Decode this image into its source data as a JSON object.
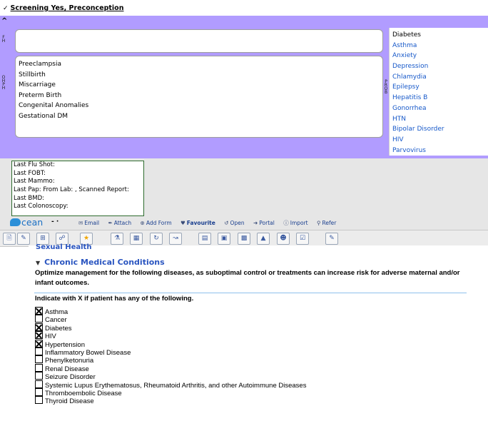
{
  "header": {
    "title": "Screening Yes, Preconception"
  },
  "purple_panel": {
    "fh_label": "F H",
    "oh_label": "O H P H",
    "prob_label": "P R O B",
    "fh_value": "",
    "oh_items": [
      "Preeclampsia",
      "Stillbirth",
      "Miscarriage",
      "Preterm Birth",
      "Congenital Anomalies",
      "Gestational DM"
    ],
    "problem_items": [
      "Diabetes",
      "Asthma",
      "Anxiety",
      "Depression",
      "Chlamydia",
      "Epilepsy",
      "Hepatitis B",
      "Gonorrhea",
      "HTN",
      "Bipolar Disorder",
      "HIV",
      "Parvovirus"
    ],
    "colors": {
      "background": "#b19cff",
      "link": "#1658c9"
    }
  },
  "last_tests": [
    "Last Flu Shot:",
    "Last FOBT:",
    "Last Mammo:",
    "Last Pap: From Lab: , Scanned Report:",
    "Last BMD:",
    "Last Colonoscopy:"
  ],
  "ocean_toolbar": {
    "logo": "cean",
    "separator": "-  ·",
    "email": "Email",
    "attach": "Attach",
    "add_form": "Add Form",
    "favourite": "Favourite",
    "open": "Open",
    "portal": "Portal",
    "import": "Import",
    "refer": "Refer"
  },
  "content": {
    "prev_section": "Sexual Health",
    "section_title": "Chronic Medical Conditions",
    "description": "Optimize management for the following diseases, as suboptimal control or treatments can increase risk for adverse maternal and/or infant outcomes.",
    "instruction": "Indicate with X if patient has any of the following.",
    "conditions": [
      {
        "label": "Asthma",
        "checked": true
      },
      {
        "label": "Cancer",
        "checked": false
      },
      {
        "label": "Diabetes",
        "checked": true
      },
      {
        "label": "HIV",
        "checked": true
      },
      {
        "label": "Hypertension",
        "checked": true
      },
      {
        "label": "Inflammatory Bowel Disease",
        "checked": false
      },
      {
        "label": "Phenylketonuria",
        "checked": false
      },
      {
        "label": "Renal Disease",
        "checked": false
      },
      {
        "label": "Seizure Disorder",
        "checked": false
      },
      {
        "label": "Systemic Lupus Erythematosus, Rheumatoid Arthritis, and other Autoimmune Diseases",
        "checked": false
      },
      {
        "label": "Thromboembolic Disease",
        "checked": false
      },
      {
        "label": "Thyroid Disease",
        "checked": false
      }
    ]
  }
}
